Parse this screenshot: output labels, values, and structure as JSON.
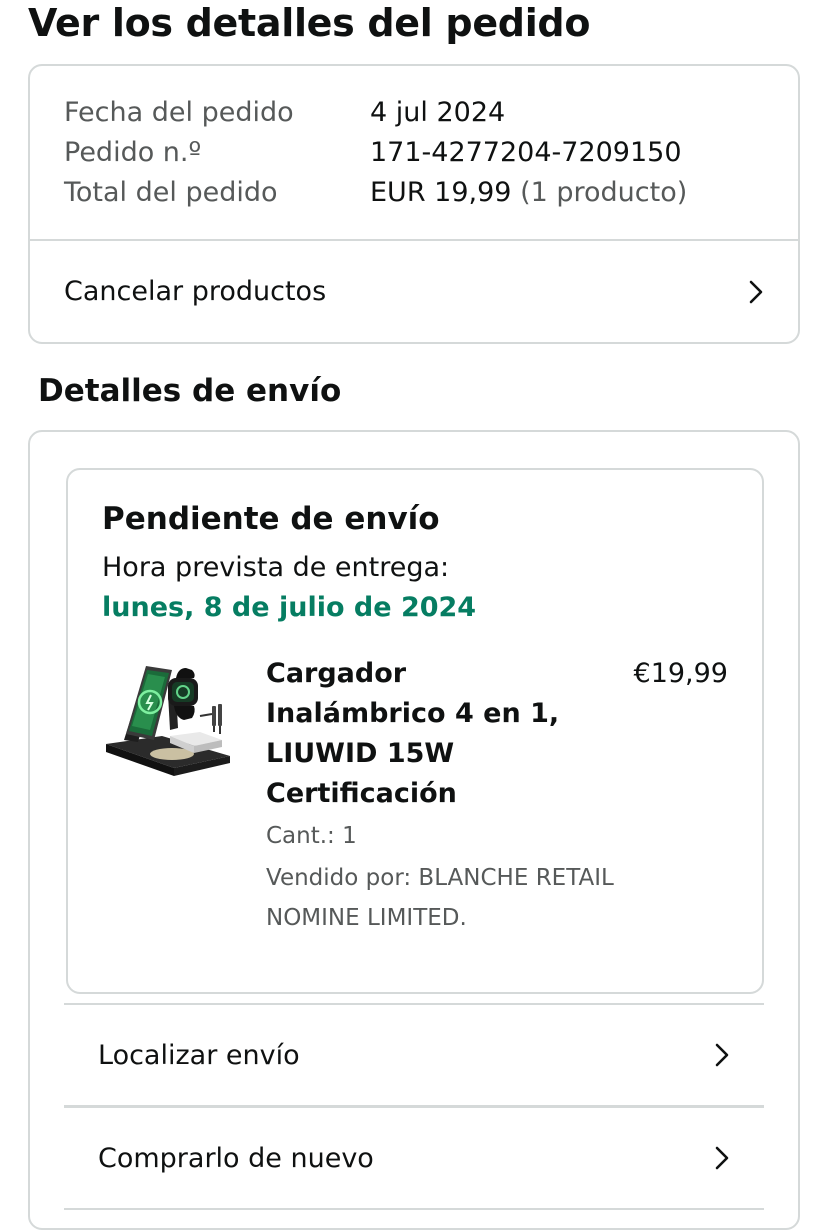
{
  "page": {
    "title": "Ver los detalles del pedido"
  },
  "order": {
    "date_label": "Fecha del pedido",
    "date_value": "4 jul 2024",
    "number_label": "Pedido n.º",
    "number_value": "171-4277204-7209150",
    "total_label": "Total del pedido",
    "total_value": "EUR 19,99",
    "total_items": "(1 producto)",
    "cancel_label": "Cancelar productos"
  },
  "shipping": {
    "section_title": "Detalles de envío",
    "status": "Pendiente de envío",
    "eta_label": "Hora prevista de entrega:",
    "eta_date": "lunes, 8 de julio de 2024",
    "eta_color": "#067d62",
    "product": {
      "title": "Cargador Inalámbrico 4 en 1, LIUWID 15W Certificación",
      "price": "€19,99",
      "quantity": "Cant.: 1",
      "seller": "Vendido por: BLANCHE RETAIL NOMINE LIMITED.",
      "image": "wireless-charger-stand"
    },
    "actions": [
      {
        "label": "Localizar envío",
        "icon": "chevron-right-icon"
      },
      {
        "label": "Comprarlo de nuevo",
        "icon": "chevron-right-icon"
      }
    ]
  }
}
